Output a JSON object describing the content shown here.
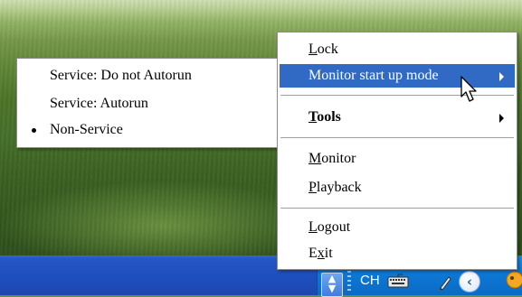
{
  "main_menu": {
    "items": [
      {
        "label": "Lock",
        "mnemonic": "L",
        "rest": "ock"
      },
      {
        "label": "Monitor start up mode",
        "mnemonic": "",
        "rest": "Monitor start up mode",
        "highlighted": true,
        "submenu": true
      },
      {
        "label": "Tools",
        "mnemonic": "T",
        "rest": "ools",
        "bold": true,
        "submenu": true
      },
      {
        "label": "Monitor",
        "mnemonic": "M",
        "rest": "onitor"
      },
      {
        "label": "Playback",
        "mnemonic": "P",
        "rest": "layback"
      },
      {
        "label": "Logout",
        "mnemonic": "L",
        "rest": "ogout"
      },
      {
        "label": "Exit",
        "pre": "E",
        "mnemonic": "x",
        "rest": "it"
      }
    ]
  },
  "sub_menu": {
    "items": [
      {
        "label": "Service: Do not Autorun",
        "checked": false
      },
      {
        "label": "Service: Autorun",
        "checked": false
      },
      {
        "label": "Non-Service",
        "checked": true
      }
    ]
  },
  "taskbar": {
    "language": "CH",
    "icons": [
      "tray-scroll-icon",
      "keyboard-icon",
      "pen-icon",
      "back-icon",
      "app-tray-icon"
    ]
  },
  "colors": {
    "highlight": "#316ac5",
    "taskbar": "#1f4fbf",
    "tray": "#0c7ad8"
  }
}
